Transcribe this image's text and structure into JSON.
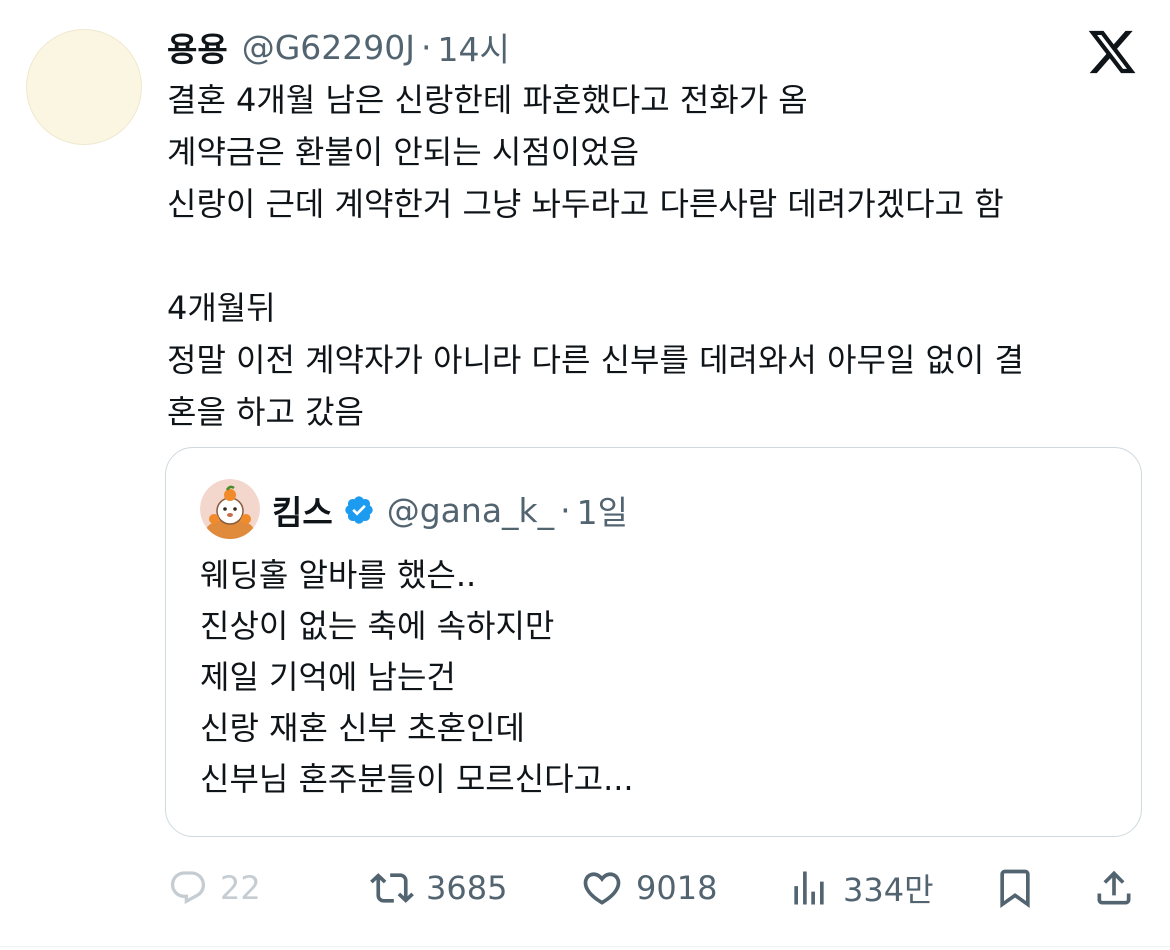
{
  "tweet": {
    "author_name": "용용",
    "author_handle": "@G62290J",
    "separator": "·",
    "time": "14시",
    "text": "결혼 4개월 남은 신랑한테 파혼했다고 전화가 옴\n계약금은 환불이 안되는 시점이었음\n신랑이 근데 계약한거 그냥 놔두라고 다른사람 데려가겠다고 함\n\n4개월뒤\n정말 이전 계약자가 아니라 다른 신부를 데려와서 아무일 없이 결\n혼을 하고 갔음"
  },
  "quoted_tweet": {
    "author_name": "킴스",
    "verified": true,
    "author_handle": "@gana_k_",
    "separator": "·",
    "time": "1일",
    "text": "웨딩홀 알바를 했슨..\n진상이 없는 축에 속하지만\n제일 기억에 남는건\n신랑 재혼 신부 초혼인데\n신부님 혼주분들이 모르신다고..."
  },
  "actions": {
    "reply_count": "22",
    "retweet_count": "3685",
    "like_count": "9018",
    "view_count": "334만"
  },
  "icons": {
    "brand": "x-logo-icon",
    "verified": "verified-badge-icon",
    "reply": "reply-icon",
    "retweet": "retweet-icon",
    "like": "heart-icon",
    "views": "views-icon",
    "bookmark": "bookmark-icon",
    "share": "share-icon"
  },
  "colors": {
    "text": "#0f1419",
    "secondary": "#536471",
    "verified": "#1d9bf0",
    "border": "#cfd9de"
  }
}
